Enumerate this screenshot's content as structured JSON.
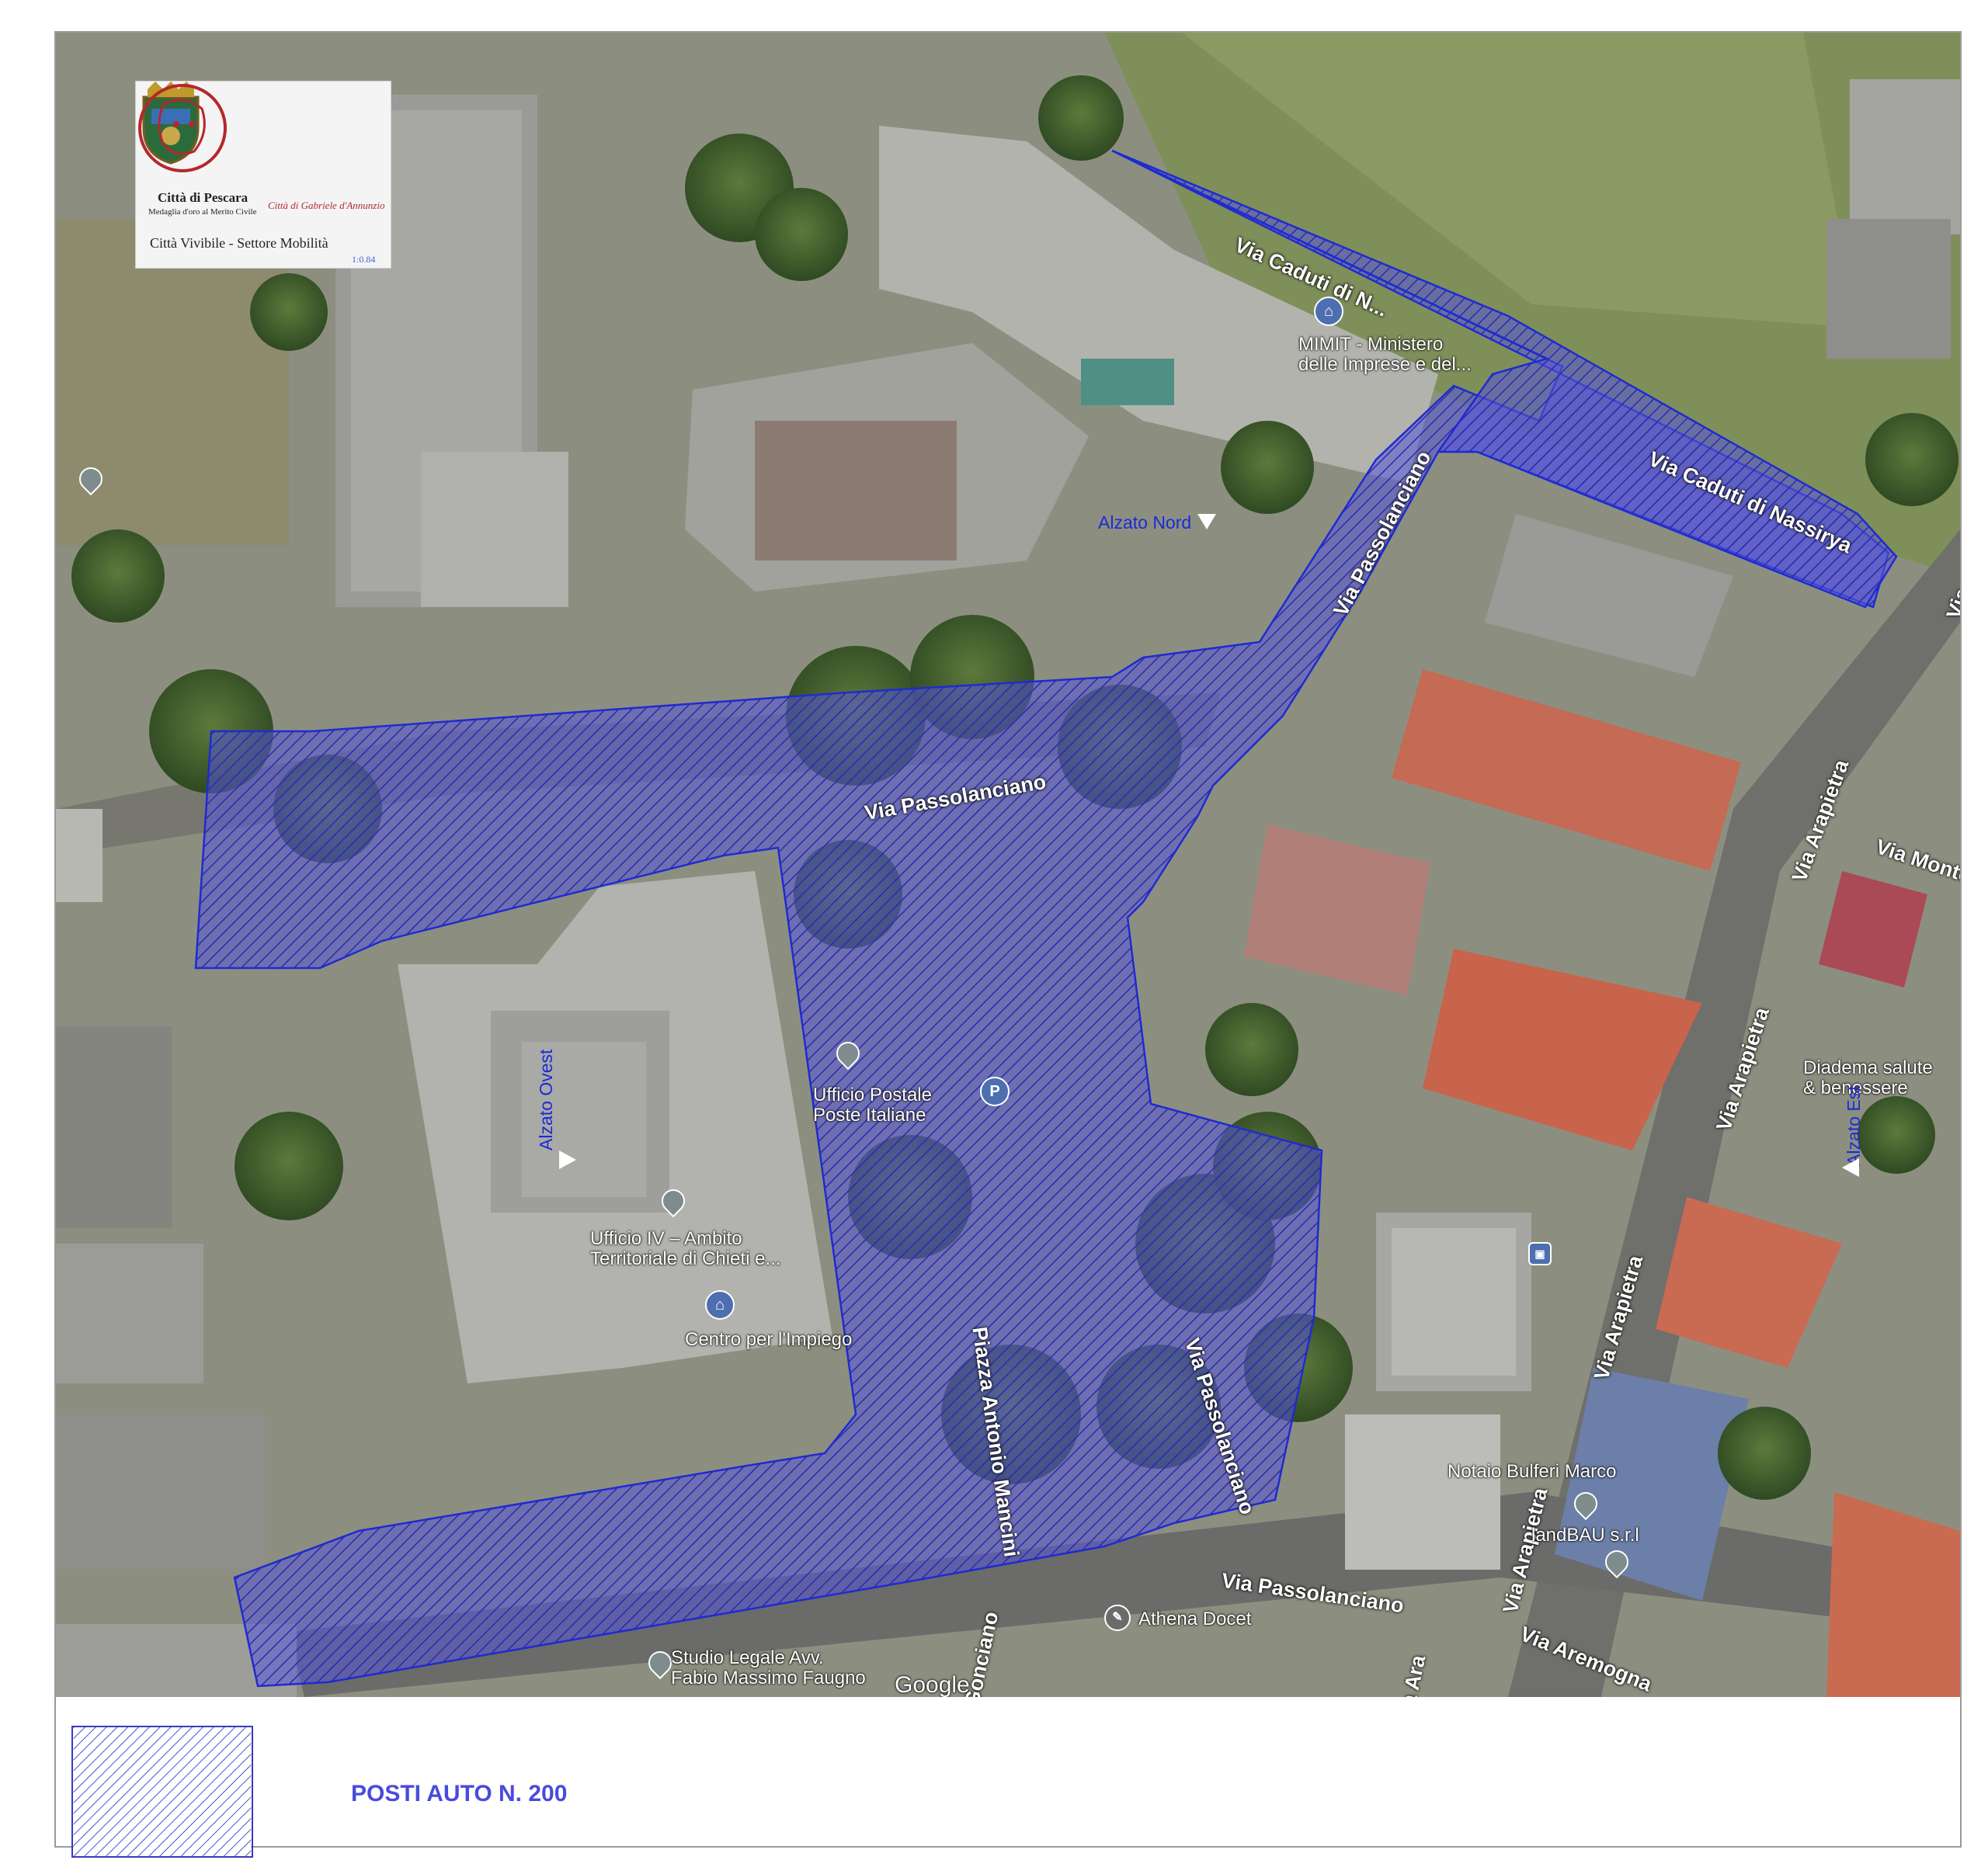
{
  "header": {
    "city_name": "Città di Pescara",
    "city_motto": "Medaglia d'oro al Merito Civile",
    "department": "Città Vivibile - Settore Mobilità",
    "scale_note": "1:0.84",
    "dannunzio_logo_text": "Città di Gabriele d'Annunzio"
  },
  "map": {
    "streets": [
      {
        "id": "caduti-1",
        "label": "Via Caduti di N..."
      },
      {
        "id": "caduti-2",
        "label": "Via Caduti di Nassirya"
      },
      {
        "id": "passolanciano-1",
        "label": "Via Passolanciano"
      },
      {
        "id": "passolanciano-2",
        "label": "Via Passolanciano"
      },
      {
        "id": "passolanciano-3",
        "label": "Via Passolanciano"
      },
      {
        "id": "passolanciano-4",
        "label": "Via Passolanciano"
      },
      {
        "id": "mancini",
        "label": "Piazza Antonio Mancini"
      },
      {
        "id": "arapietra-1",
        "label": "Via Arapietra"
      },
      {
        "id": "arapietra-2",
        "label": "Via Arapietra"
      },
      {
        "id": "arapietra-3",
        "label": "Via Arapietra"
      },
      {
        "id": "arapietra-4",
        "label": "Via Arapietra"
      },
      {
        "id": "arapietra-5",
        "label": "Via Ara"
      },
      {
        "id": "aremogna",
        "label": "Via Aremogna"
      },
      {
        "id": "monte",
        "label": "Via Monte Am"
      },
      {
        "id": "gonciano",
        "label": "Gonciano"
      }
    ],
    "pois": {
      "mimit_1": "MIMIT - Ministero",
      "mimit_2": "delle Imprese e del...",
      "ufficio_postale_1": "Ufficio Postale",
      "ufficio_postale_2": "Poste Italiane",
      "ufficio_iv_1": "Ufficio IV – Ambito",
      "ufficio_iv_2": "Territoriale di Chieti e...",
      "centro_impiego": "Centro per l'Impiego",
      "diadema_1": "Diadema salute",
      "diadema_2": "& benessere",
      "notaio": "Notaio Bulferi Marco",
      "landbau": "landBAU s.r.l",
      "athena": "Athena Docet",
      "studio_1": "Studio Legale Avv.",
      "studio_2": "Fabio Massimo Faugno",
      "google": "Google"
    },
    "raised_crossings": {
      "north": "Alzato Nord",
      "west": "Alzato Ovest",
      "east": "Alzato Est"
    },
    "colors": {
      "parking_fill": "#4b4bd6",
      "parking_stroke": "#1f2bd0",
      "hatch": "#2a2ab0"
    }
  },
  "legend": {
    "label": "POSTI AUTO N. 200"
  }
}
